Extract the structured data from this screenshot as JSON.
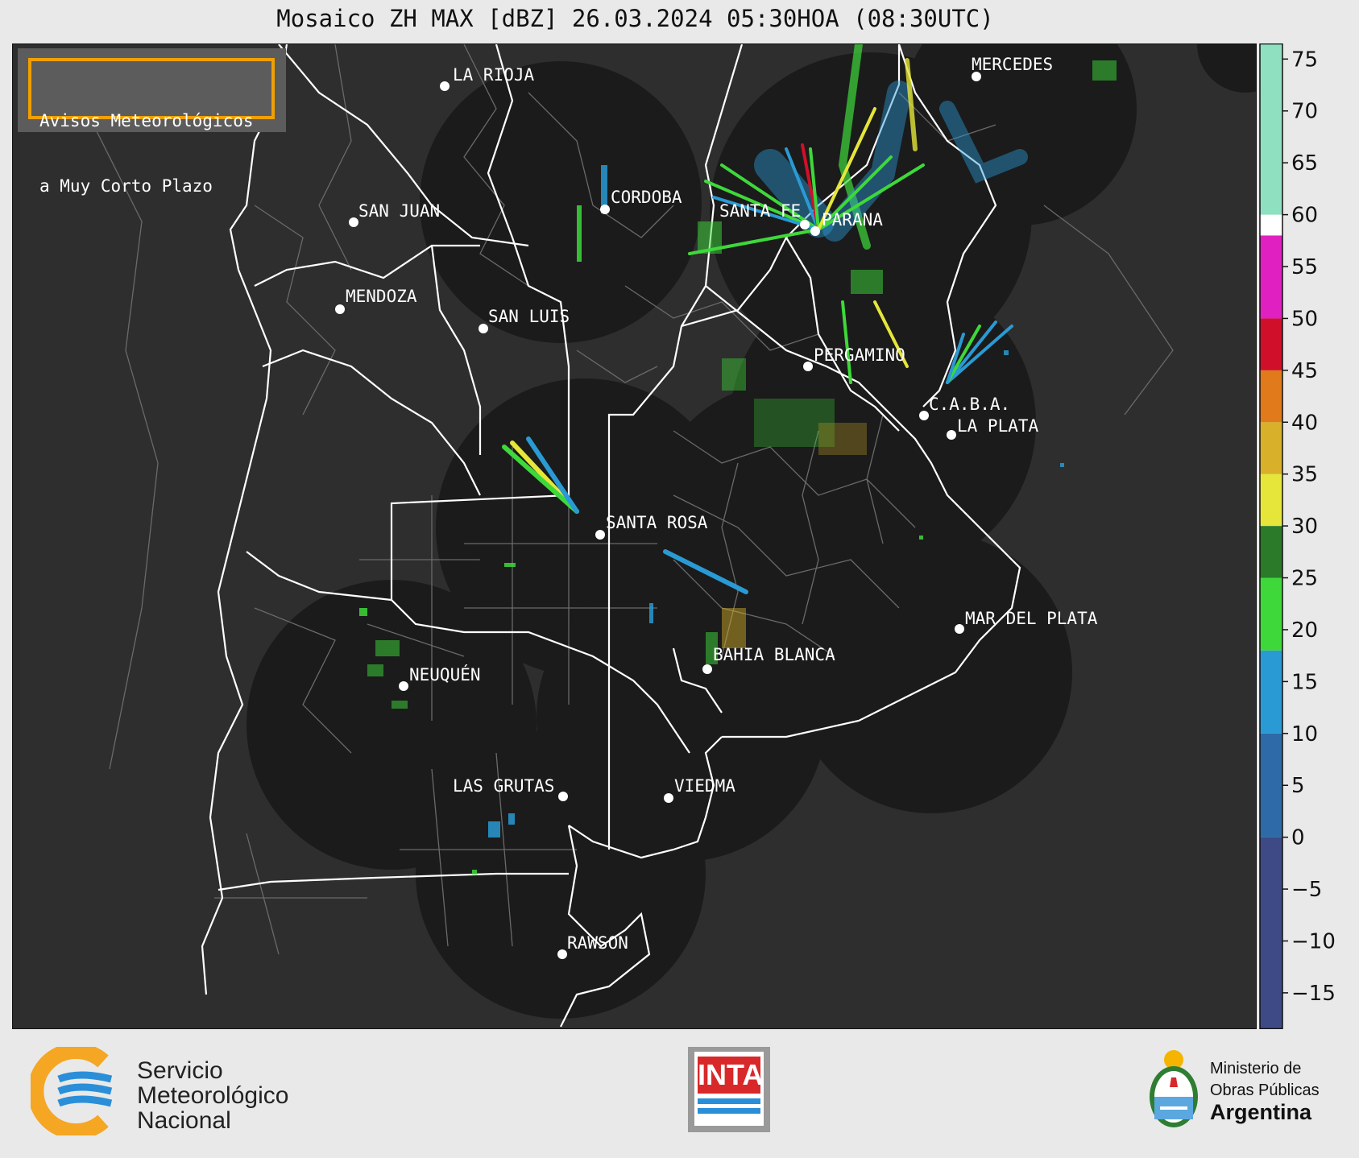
{
  "title": "Mosaico ZH MAX [dBZ] 26.03.2024 05:30HOA (08:30UTC)",
  "avisos": {
    "line1": "Avisos Meteorológicos",
    "line2": "a Muy Corto Plazo"
  },
  "cities": [
    {
      "name": "LA RIOJA"
    },
    {
      "name": "MERCEDES"
    },
    {
      "name": "SAN JUAN"
    },
    {
      "name": "CORDOBA"
    },
    {
      "name": "SANTA FE"
    },
    {
      "name": "PARANA"
    },
    {
      "name": "MENDOZA"
    },
    {
      "name": "SAN LUIS"
    },
    {
      "name": "PERGAMINO"
    },
    {
      "name": "C.A.B.A."
    },
    {
      "name": "LA PLATA"
    },
    {
      "name": "SANTA ROSA"
    },
    {
      "name": "MAR DEL PLATA"
    },
    {
      "name": "BAHIA BLANCA"
    },
    {
      "name": "NEUQUÉN"
    },
    {
      "name": "LAS GRUTAS"
    },
    {
      "name": "VIEDMA"
    },
    {
      "name": "RAWSON"
    }
  ],
  "colorbar": {
    "ticks": [
      "75",
      "70",
      "65",
      "60",
      "55",
      "50",
      "45",
      "40",
      "35",
      "30",
      "25",
      "20",
      "15",
      "10",
      "5",
      "0",
      "−5",
      "−10",
      "−15"
    ],
    "range": [
      -18.5,
      76.5
    ],
    "bands": [
      {
        "from": -18.5,
        "to": 0,
        "color": "#3d4a85"
      },
      {
        "from": 0,
        "to": 10,
        "color": "#2f6aa8"
      },
      {
        "from": 10,
        "to": 18,
        "color": "#2a9ad4"
      },
      {
        "from": 18,
        "to": 25,
        "color": "#3ed83a"
      },
      {
        "from": 25,
        "to": 30,
        "color": "#2a7a2a"
      },
      {
        "from": 30,
        "to": 35,
        "color": "#e6e63a"
      },
      {
        "from": 35,
        "to": 40,
        "color": "#d8b02a"
      },
      {
        "from": 40,
        "to": 45,
        "color": "#e07a1a"
      },
      {
        "from": 45,
        "to": 50,
        "color": "#d0102a"
      },
      {
        "from": 50,
        "to": 58,
        "color": "#e020c0"
      },
      {
        "from": 58,
        "to": 60,
        "color": "#ffffff"
      },
      {
        "from": 60,
        "to": 76.5,
        "color": "#8fe0c0"
      }
    ]
  },
  "footer": {
    "smn": {
      "line1": "Servicio",
      "line2": "Meteorológico",
      "line3": "Nacional"
    },
    "inta": "INTA",
    "ministerio": {
      "line1": "Ministerio de",
      "line2": "Obras Públicas",
      "line3": "Argentina"
    }
  },
  "colors": {
    "map_bg": "#2e2e2e",
    "radar_disk": "#1b1b1b",
    "border_white": "#ffffff",
    "avisos_frame": "#f0a000",
    "smn_orange": "#f5a623",
    "smn_blue": "#2a8fd8",
    "inta_red": "#d8282a"
  }
}
